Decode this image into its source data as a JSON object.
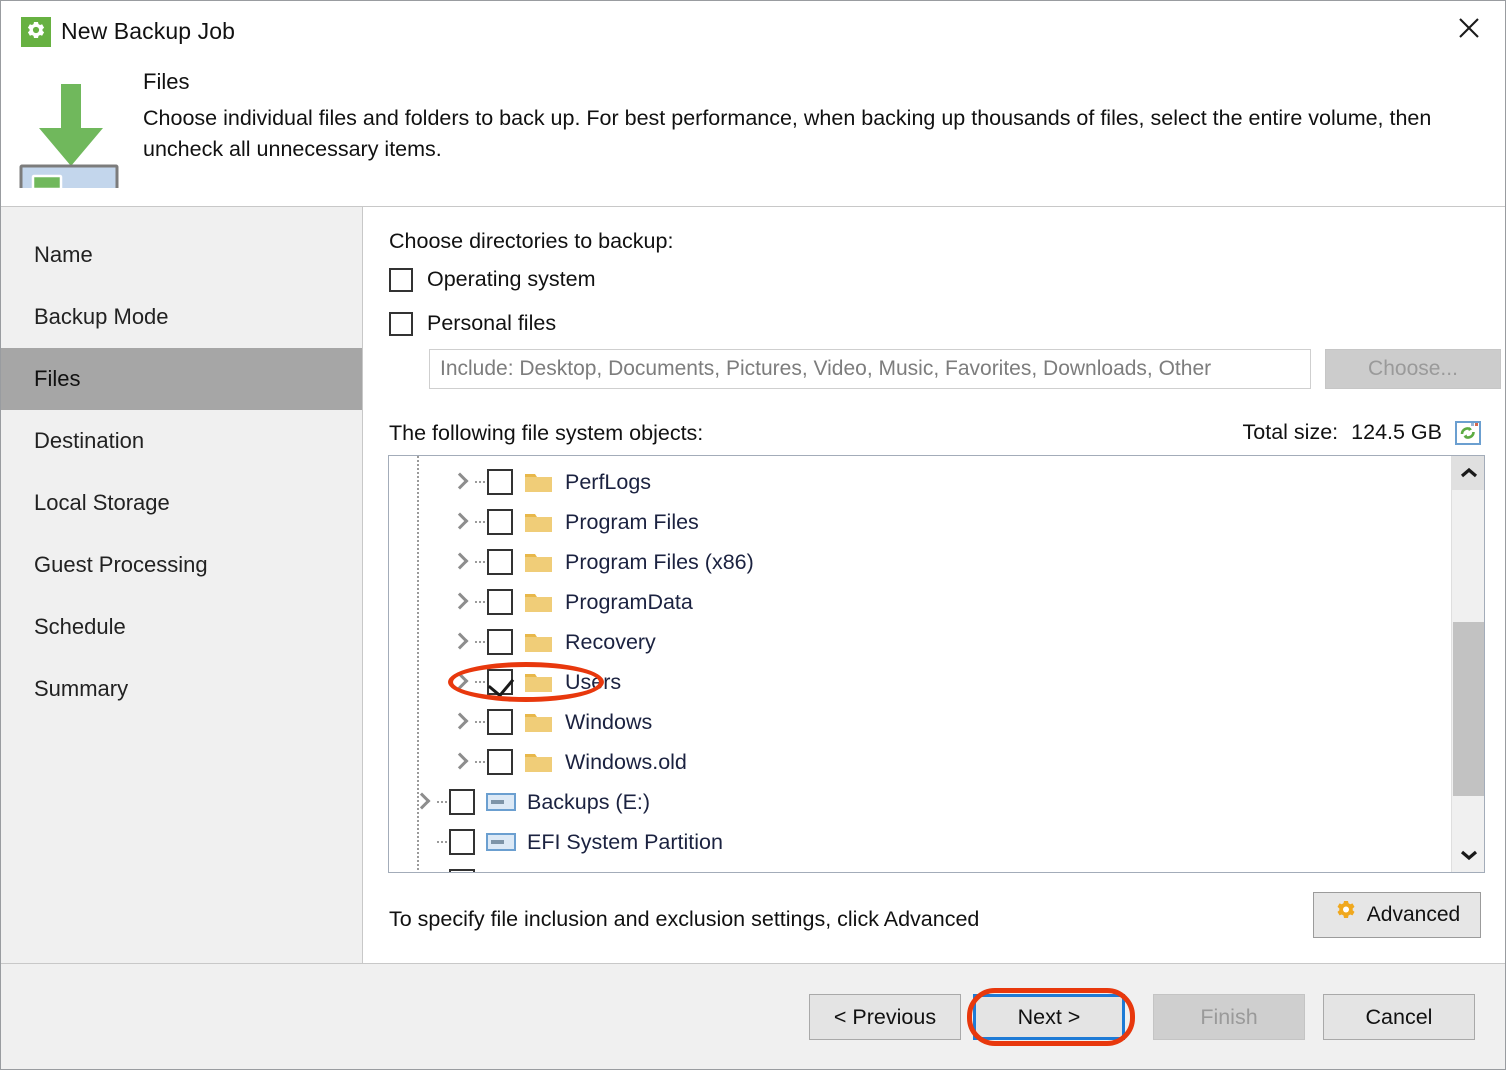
{
  "window": {
    "title": "New Backup Job",
    "app_icon": "gear-icon",
    "close_icon": "close-icon"
  },
  "header": {
    "icon": "backup-to-disk-icon",
    "title": "Files",
    "description": "Choose individual files and folders to back up. For best performance, when backing up thousands of files, select the entire volume, then uncheck all unnecessary items."
  },
  "sidebar": {
    "items": [
      {
        "label": "Name",
        "active": false
      },
      {
        "label": "Backup Mode",
        "active": false
      },
      {
        "label": "Files",
        "active": true
      },
      {
        "label": "Destination",
        "active": false
      },
      {
        "label": "Local Storage",
        "active": false
      },
      {
        "label": "Guest Processing",
        "active": false
      },
      {
        "label": "Schedule",
        "active": false
      },
      {
        "label": "Summary",
        "active": false
      }
    ]
  },
  "main": {
    "choose_directories_label": "Choose directories to backup:",
    "checkboxes": [
      {
        "label": "Operating system",
        "checked": false
      },
      {
        "label": "Personal files",
        "checked": false
      }
    ],
    "include_field": {
      "value": "Include: Desktop, Documents, Pictures, Video, Music, Favorites, Downloads, Other",
      "enabled": false
    },
    "choose_button": {
      "label": "Choose...",
      "enabled": false
    },
    "file_objects_label": "The following file system objects:",
    "total_size_label": "Total size:",
    "total_size_value": "124.5 GB",
    "refresh_icon": "refresh-icon",
    "tree": [
      {
        "label": "PerfLogs",
        "checked": false,
        "level": 1,
        "icon": "folder-icon",
        "expandable": true,
        "annotated": false
      },
      {
        "label": "Program Files",
        "checked": false,
        "level": 1,
        "icon": "folder-icon",
        "expandable": true,
        "annotated": false
      },
      {
        "label": "Program Files (x86)",
        "checked": false,
        "level": 1,
        "icon": "folder-icon",
        "expandable": true,
        "annotated": false
      },
      {
        "label": "ProgramData",
        "checked": false,
        "level": 1,
        "icon": "folder-icon",
        "expandable": true,
        "annotated": false
      },
      {
        "label": "Recovery",
        "checked": false,
        "level": 1,
        "icon": "folder-icon",
        "expandable": true,
        "annotated": false
      },
      {
        "label": "Users",
        "checked": true,
        "level": 1,
        "icon": "folder-icon",
        "expandable": true,
        "annotated": true
      },
      {
        "label": "Windows",
        "checked": false,
        "level": 1,
        "icon": "folder-icon",
        "expandable": true,
        "annotated": false
      },
      {
        "label": "Windows.old",
        "checked": false,
        "level": 1,
        "icon": "folder-icon",
        "expandable": true,
        "annotated": false
      },
      {
        "label": "Backups (E:)",
        "checked": false,
        "level": 0,
        "icon": "drive-icon",
        "expandable": true,
        "annotated": false
      },
      {
        "label": "EFI System Partition",
        "checked": false,
        "level": 0,
        "icon": "drive-icon",
        "expandable": false,
        "annotated": false
      }
    ],
    "scrollbar": {
      "up_icon": "chevron-up-icon",
      "down_icon": "chevron-down-icon"
    },
    "advanced_hint": "To specify file inclusion and exclusion settings, click Advanced",
    "advanced_button": {
      "label": "Advanced",
      "icon": "gear-icon"
    }
  },
  "footer": {
    "buttons": [
      {
        "label": "< Previous",
        "enabled": true,
        "focused": false,
        "annotated": false
      },
      {
        "label": "Next >",
        "enabled": true,
        "focused": true,
        "annotated": true
      },
      {
        "label": "Finish",
        "enabled": false,
        "focused": false,
        "annotated": false
      },
      {
        "label": "Cancel",
        "enabled": true,
        "focused": false,
        "annotated": false
      }
    ]
  },
  "colors": {
    "accent_green": "#67b141",
    "annotation_red": "#e8380d",
    "focus_blue": "#1e7bd6",
    "folder_yellow": "#e8b84b",
    "selection_grey": "#a6a6a6"
  }
}
